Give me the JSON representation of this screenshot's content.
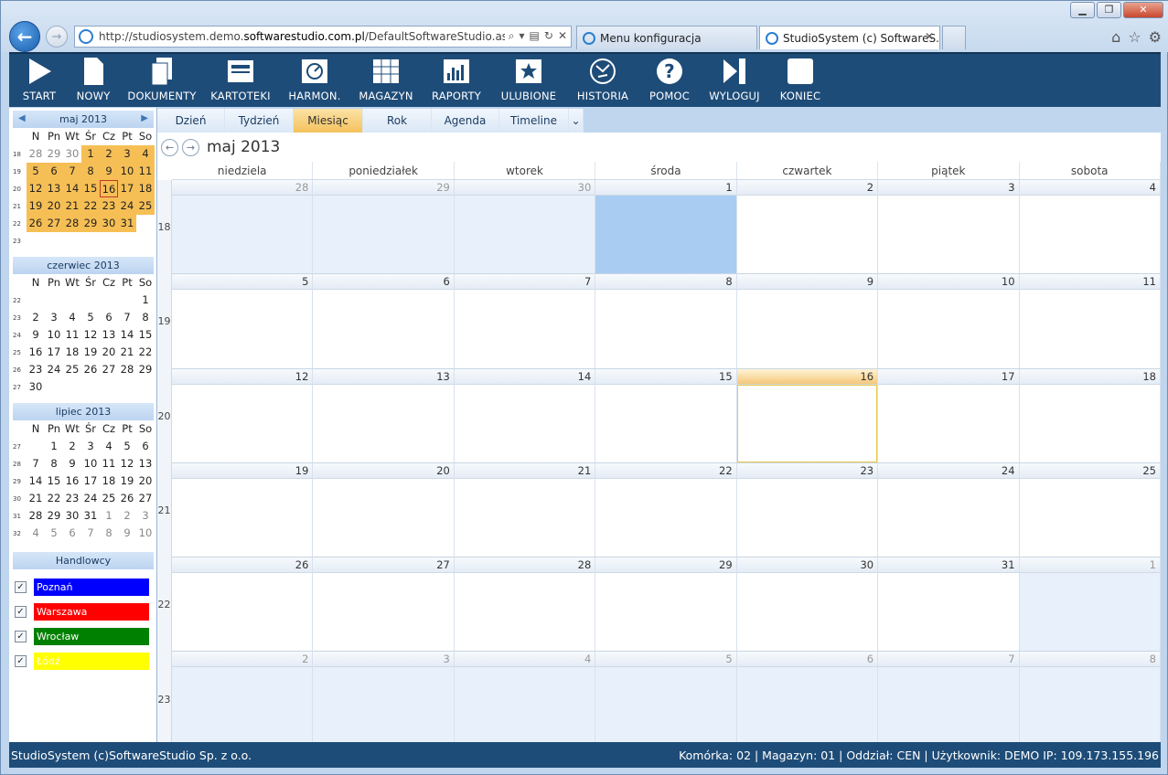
{
  "browser": {
    "url_prefix": "http://studiosystem.demo.",
    "url_host": "softwarestudio.com.pl",
    "url_path": "/DefaultSoftwareStudio.aspx?rola",
    "tabs": [
      {
        "label": "Menu konfiguracja"
      },
      {
        "label": "StudioSystem (c) SoftwareS..."
      }
    ],
    "window_controls": {
      "minimize": "▁",
      "restore": "❐",
      "close": "✕"
    }
  },
  "toolbar": {
    "items": [
      {
        "label": "START",
        "icon": "play-icon"
      },
      {
        "label": "NOWY",
        "icon": "new-document-icon"
      },
      {
        "label": "DOKUMENTY",
        "icon": "documents-icon"
      },
      {
        "label": "KARTOTEKI",
        "icon": "cards-icon"
      },
      {
        "label": "HARMON.",
        "icon": "schedule-icon"
      },
      {
        "label": "MAGAZYN",
        "icon": "warehouse-icon"
      },
      {
        "label": "RAPORTY",
        "icon": "reports-icon"
      },
      {
        "label": "ULUBIONE",
        "icon": "favorites-icon"
      },
      {
        "label": "HISTORIA",
        "icon": "history-icon"
      },
      {
        "label": "POMOC",
        "icon": "help-icon"
      },
      {
        "label": "WYLOGUJ",
        "icon": "logout-icon"
      },
      {
        "label": "KONIEC",
        "icon": "exit-icon"
      }
    ]
  },
  "minicals": [
    {
      "title": "maj 2013",
      "weekdays": [
        "N",
        "Pn",
        "Wt",
        "Śr",
        "Cz",
        "Pt",
        "So"
      ],
      "weeks": [
        {
          "wk": "18",
          "days": [
            "28",
            "29",
            "30",
            "1",
            "2",
            "3",
            "4"
          ]
        },
        {
          "wk": "19",
          "days": [
            "5",
            "6",
            "7",
            "8",
            "9",
            "10",
            "11"
          ]
        },
        {
          "wk": "20",
          "days": [
            "12",
            "13",
            "14",
            "15",
            "16",
            "17",
            "18"
          ]
        },
        {
          "wk": "21",
          "days": [
            "19",
            "20",
            "21",
            "22",
            "23",
            "24",
            "25"
          ]
        },
        {
          "wk": "22",
          "days": [
            "26",
            "27",
            "28",
            "29",
            "30",
            "31",
            ""
          ]
        },
        {
          "wk": "23",
          "days": [
            "",
            "",
            "",
            "",
            "",
            "",
            ""
          ]
        }
      ]
    },
    {
      "title": "czerwiec 2013",
      "weekdays": [
        "N",
        "Pn",
        "Wt",
        "Śr",
        "Cz",
        "Pt",
        "So"
      ],
      "weeks": [
        {
          "wk": "22",
          "days": [
            "",
            "",
            "",
            "",
            "",
            "",
            "1"
          ]
        },
        {
          "wk": "23",
          "days": [
            "2",
            "3",
            "4",
            "5",
            "6",
            "7",
            "8"
          ]
        },
        {
          "wk": "24",
          "days": [
            "9",
            "10",
            "11",
            "12",
            "13",
            "14",
            "15"
          ]
        },
        {
          "wk": "25",
          "days": [
            "16",
            "17",
            "18",
            "19",
            "20",
            "21",
            "22"
          ]
        },
        {
          "wk": "26",
          "days": [
            "23",
            "24",
            "25",
            "26",
            "27",
            "28",
            "29"
          ]
        },
        {
          "wk": "27",
          "days": [
            "30",
            "",
            "",
            "",
            "",
            "",
            ""
          ]
        }
      ]
    },
    {
      "title": "lipiec 2013",
      "weekdays": [
        "N",
        "Pn",
        "Wt",
        "Śr",
        "Cz",
        "Pt",
        "So"
      ],
      "weeks": [
        {
          "wk": "27",
          "days": [
            "",
            "1",
            "2",
            "3",
            "4",
            "5",
            "6"
          ]
        },
        {
          "wk": "28",
          "days": [
            "7",
            "8",
            "9",
            "10",
            "11",
            "12",
            "13"
          ]
        },
        {
          "wk": "29",
          "days": [
            "14",
            "15",
            "16",
            "17",
            "18",
            "19",
            "20"
          ]
        },
        {
          "wk": "30",
          "days": [
            "21",
            "22",
            "23",
            "24",
            "25",
            "26",
            "27"
          ]
        },
        {
          "wk": "31",
          "days": [
            "28",
            "29",
            "30",
            "31",
            "1",
            "2",
            "3"
          ]
        },
        {
          "wk": "32",
          "days": [
            "4",
            "5",
            "6",
            "7",
            "8",
            "9",
            "10"
          ]
        }
      ]
    }
  ],
  "handlowcy": {
    "title": "Handlowcy",
    "items": [
      {
        "label": "Poznań",
        "color": "#0000ff"
      },
      {
        "label": "Warszawa",
        "color": "#ff0000"
      },
      {
        "label": "Wrocław",
        "color": "#008000"
      },
      {
        "label": "Łódź",
        "color": "#ffff00"
      }
    ]
  },
  "views": [
    "Dzień",
    "Tydzień",
    "Miesiąc",
    "Rok",
    "Agenda",
    "Timeline"
  ],
  "active_view": "Miesiąc",
  "calendar": {
    "title": "maj 2013",
    "day_names": [
      "niedziela",
      "poniedziałek",
      "wtorek",
      "środa",
      "czwartek",
      "piątek",
      "sobota"
    ],
    "weeks": [
      {
        "wk": "18",
        "days": [
          "28",
          "29",
          "30",
          "1",
          "2",
          "3",
          "4"
        ]
      },
      {
        "wk": "19",
        "days": [
          "5",
          "6",
          "7",
          "8",
          "9",
          "10",
          "11"
        ]
      },
      {
        "wk": "20",
        "days": [
          "12",
          "13",
          "14",
          "15",
          "16",
          "17",
          "18"
        ]
      },
      {
        "wk": "21",
        "days": [
          "19",
          "20",
          "21",
          "22",
          "23",
          "24",
          "25"
        ]
      },
      {
        "wk": "22",
        "days": [
          "26",
          "27",
          "28",
          "29",
          "30",
          "31",
          "1"
        ]
      },
      {
        "wk": "23",
        "days": [
          "2",
          "3",
          "4",
          "5",
          "6",
          "7",
          "8"
        ]
      }
    ],
    "today": "16",
    "selected": "1"
  },
  "status": {
    "left": "StudioSystem (c)SoftwareStudio Sp. z o.o.",
    "right": "Komórka: 02 | Magazyn: 01 | Oddział: CEN | Użytkownik: DEMO IP: 109.173.155.196"
  }
}
